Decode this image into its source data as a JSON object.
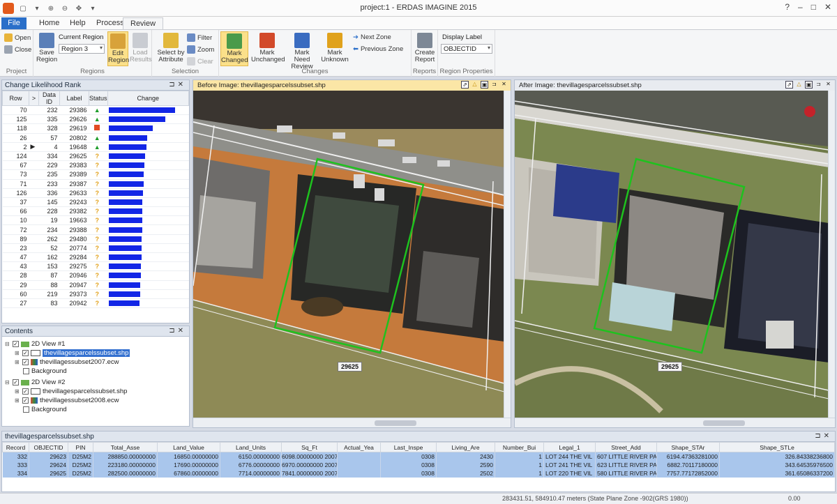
{
  "window": {
    "title": "project:1 - ERDAS IMAGINE 2015",
    "controls": [
      "?",
      "–",
      "□",
      "✕"
    ]
  },
  "tabs": [
    "File",
    "Home",
    "Help",
    "Process",
    "Review"
  ],
  "ribbon": {
    "project": {
      "open": "Open",
      "close": "Close",
      "label": "Project"
    },
    "regions": {
      "save": "Save Region",
      "current_region_label": "Current Region",
      "current_region_value": "Region 3",
      "edit": "Edit Region",
      "load": "Load Results",
      "label": "Regions"
    },
    "selection": {
      "select_by_attr": "Select by Attribute",
      "filter": "Filter",
      "zoom": "Zoom",
      "clear": "Clear",
      "label": "Selection"
    },
    "changes": {
      "mark_changed": "Mark Changed",
      "mark_unchanged": "Mark Unchanged",
      "mark_need_review": "Mark Need Review",
      "mark_unknown": "Mark Unknown",
      "next_zone": "Next Zone",
      "previous_zone": "Previous Zone",
      "label": "Changes"
    },
    "reports": {
      "create_report": "Create Report",
      "label": "Reports"
    },
    "region_props": {
      "display_label": "Display Label",
      "display_label_value": "OBJECTID",
      "label": "Region Properties"
    }
  },
  "rank_panel": {
    "title": "Change Likelihood Rank",
    "columns": [
      "Row",
      ">",
      "Data ID",
      "Label",
      "Status",
      "Change"
    ],
    "rows": [
      {
        "row": "70",
        "id": "232",
        "label": "29386",
        "status": "up",
        "change": 1.0
      },
      {
        "row": "125",
        "id": "335",
        "label": "29626",
        "status": "up",
        "change": 0.85
      },
      {
        "row": "118",
        "id": "328",
        "label": "29619",
        "status": "sq",
        "change": 0.66
      },
      {
        "row": "26",
        "id": "57",
        "label": "20802",
        "status": "up",
        "change": 0.58
      },
      {
        "row": "2",
        "id": "4",
        "label": "19648",
        "status": "up",
        "change": 0.57,
        "current": true
      },
      {
        "row": "124",
        "id": "334",
        "label": "29625",
        "status": "q",
        "change": 0.55
      },
      {
        "row": "67",
        "id": "229",
        "label": "29383",
        "status": "q",
        "change": 0.54
      },
      {
        "row": "73",
        "id": "235",
        "label": "29389",
        "status": "q",
        "change": 0.53
      },
      {
        "row": "71",
        "id": "233",
        "label": "29387",
        "status": "q",
        "change": 0.53
      },
      {
        "row": "126",
        "id": "336",
        "label": "29633",
        "status": "q",
        "change": 0.52
      },
      {
        "row": "37",
        "id": "145",
        "label": "29243",
        "status": "q",
        "change": 0.51
      },
      {
        "row": "66",
        "id": "228",
        "label": "29382",
        "status": "q",
        "change": 0.51
      },
      {
        "row": "10",
        "id": "19",
        "label": "19663",
        "status": "q",
        "change": 0.5
      },
      {
        "row": "72",
        "id": "234",
        "label": "29388",
        "status": "q",
        "change": 0.5
      },
      {
        "row": "89",
        "id": "262",
        "label": "29480",
        "status": "q",
        "change": 0.49
      },
      {
        "row": "23",
        "id": "52",
        "label": "20774",
        "status": "q",
        "change": 0.49
      },
      {
        "row": "47",
        "id": "162",
        "label": "29284",
        "status": "q",
        "change": 0.49
      },
      {
        "row": "43",
        "id": "153",
        "label": "29275",
        "status": "q",
        "change": 0.48
      },
      {
        "row": "28",
        "id": "87",
        "label": "20946",
        "status": "q",
        "change": 0.48
      },
      {
        "row": "29",
        "id": "88",
        "label": "20947",
        "status": "q",
        "change": 0.47
      },
      {
        "row": "60",
        "id": "219",
        "label": "29373",
        "status": "q",
        "change": 0.47
      },
      {
        "row": "27",
        "id": "83",
        "label": "20942",
        "status": "q",
        "change": 0.46
      }
    ]
  },
  "contents": {
    "title": "Contents",
    "view1": {
      "name": "2D View #1",
      "layer1": "thevillagesparcelssubset.shp",
      "layer2": "thevillagessubset2007.ecw",
      "bg": "Background"
    },
    "view2": {
      "name": "2D View #2",
      "layer1": "thevillagesparcelssubset.shp",
      "layer2": "thevillagessubset2008.ecw",
      "bg": "Background"
    }
  },
  "before_view": {
    "title": "Before Image: thevillagesparcelssubset.shp",
    "parcel_label": "29625"
  },
  "after_view": {
    "title": "After Image: thevillagesparcelssubset.shp",
    "parcel_label": "29625"
  },
  "attr_table": {
    "title": "thevillagesparcelssubset.shp",
    "columns": [
      "Record",
      "OBJECTID",
      "PIN",
      "Total_Asse",
      "Land_Value",
      "Land_Units",
      "Sq_Ft",
      "Actual_Yea",
      "Last_Inspe",
      "Living_Are",
      "Number_Bui",
      "Legal_1",
      "Street_Add",
      "Shape_STAr",
      "Shape_STLe"
    ],
    "rows": [
      [
        "332",
        "29623",
        "D25M2",
        "288850.00000000",
        "16850.00000000",
        "6150.00000000",
        "6098.00000000 2007",
        "",
        "0308",
        "2430",
        "1",
        "LOT 244 THE VIL",
        "607 LITTLE RIVER PATH",
        "6194.47363281000",
        "326.84338236800"
      ],
      [
        "333",
        "29624",
        "D25M2",
        "223180.00000000",
        "17690.00000000",
        "6776.00000000",
        "6970.00000000 2007",
        "",
        "0308",
        "2590",
        "1",
        "LOT 241 THE VIL",
        "623 LITTLE RIVER PATH",
        "6882.70117180000",
        "343.64535976500"
      ],
      [
        "334",
        "29625",
        "D25M2",
        "282500.00000000",
        "67860.00000000",
        "7714.00000000",
        "7841.00000000 2007",
        "",
        "0308",
        "2502",
        "1",
        "LOT 220 THE VIL",
        "580 LITTLE RIVER PATH",
        "7757.77172852000",
        "361.65086337200"
      ]
    ]
  },
  "status": {
    "coords": "283431.51, 584910.47 meters (State Plane Zone -902(GRS 1980))",
    "value": "0.00"
  }
}
